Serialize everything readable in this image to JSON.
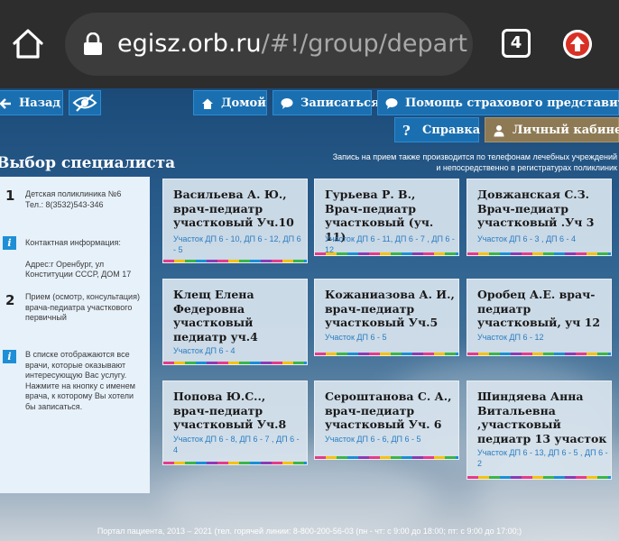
{
  "browser": {
    "url_host": "egisz.orb.ru",
    "url_path": "/#!/group/depart",
    "tabs_count": "4"
  },
  "nav": {
    "back": "Назад",
    "home": "Домой",
    "signup": "Записаться",
    "insurance_help": "Помощь страхового представителя",
    "help": "Справка",
    "cabinet": "Личный кабинет"
  },
  "page": {
    "title": "Выбор специалиста",
    "notice_line1": "Запись на прием также производится по телефонам лечебных учреждений",
    "notice_line2": "и непосредственно в регистратурах поликлиник"
  },
  "sidebar": {
    "step1_num": "1",
    "clinic_line1": "Детская поликлиника №6",
    "clinic_line2": "Тел.: 8(3532)543-346",
    "contact_title": "Контактная информация:",
    "contact_line1": "Адрес:г Оренбург, ул",
    "contact_line2": "Конституции СССР, ДОМ 17",
    "step2_num": "2",
    "service_line1": "Прием (осмотр, консультация)",
    "service_line2": "врача-педиатра участкового",
    "service_line3": "первичный",
    "hint_line1": "В списке отображаются все",
    "hint_line2": "врачи, которые оказывают",
    "hint_line3": "интересующую Вас услугу.",
    "hint_line4": "Нажмите на кнопку с именем",
    "hint_line5": "врача, к которому Вы хотели",
    "hint_line6": "бы записаться."
  },
  "doctors": [
    {
      "name": "Васильева А. Ю., врач-педиатр участковый Уч.10",
      "area": "Участок ДП 6 - 10, ДП 6 - 12, ДП 6 - 5"
    },
    {
      "name": "Гурьева Р. В., Врач-педиатр участковый (уч. 11)",
      "area": "Участок ДП 6 - 11, ДП 6 - 7 , ДП 6 - 12"
    },
    {
      "name": "Довжанская С.З. Врач-педиатр участковый .Уч 3",
      "area": "Участок ДП 6 - 3 , ДП 6 - 4"
    },
    {
      "name": "Клещ Елена Федеровна участковый педиатр уч.4",
      "area": "Участок ДП 6 - 4"
    },
    {
      "name": "Кожаниазова А. И., врач-педиатр участковый Уч.5",
      "area": "Участок ДП 6 - 5"
    },
    {
      "name": "Оробец А.Е. врач-педиатр участковый, уч 12",
      "area": "Участок ДП 6 - 12"
    },
    {
      "name": "Попова Ю.С.., врач-педиатр участковый Уч.8",
      "area": "Участок ДП 6 - 8, ДП 6 - 7 , ДП 6 - 4"
    },
    {
      "name": "Сероштанова С. А., врач-педиатр участковый Уч. 6",
      "area": "Участок ДП 6 - 6, ДП 6 - 5"
    },
    {
      "name": "Шиндяева Анна Витальевна ,участковый педиатр 13 участок",
      "area": "Участок ДП 6 - 13, ДП 6 - 5 , ДП 6 - 2"
    }
  ],
  "footer": {
    "text": "Портал пациента, 2013 – 2021 (тел. горячей линии: 8-800-200-56-03 (пн - чт: с 9:00 до 18:00; пт: с 9:00 до 17:00;)"
  },
  "colors": {
    "button_blue": "#1a6fb0",
    "button_brown": "#8d7a55",
    "link_blue": "#2a7cc0"
  }
}
